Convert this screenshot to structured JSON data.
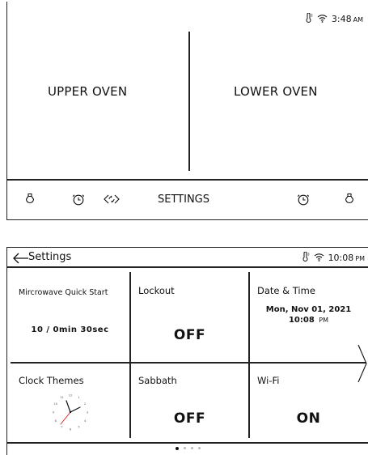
{
  "home": {
    "status": {
      "time": "3:48",
      "ampm": "AM"
    },
    "left_panel": {
      "label": "UPPER OVEN"
    },
    "right_panel": {
      "label": "LOWER OVEN"
    },
    "bottom_bar": {
      "settings_label": "SETTINGS"
    }
  },
  "settings": {
    "title": "Settings",
    "status": {
      "time": "10:08",
      "ampm": "PM"
    },
    "tiles": [
      {
        "title": "Mircrowave Quick Start",
        "value": "10 / 0min 30sec"
      },
      {
        "title": "Lockout",
        "value": "OFF"
      },
      {
        "title": "Date & Time",
        "date": "Mon, Nov 01, 2021",
        "time": "10:08",
        "ampm": "PM"
      },
      {
        "title": "Clock Themes",
        "clock_numbers": [
          "12",
          "1",
          "2",
          "3",
          "4",
          "5",
          "6",
          "7",
          "8",
          "9",
          "10",
          "11"
        ]
      },
      {
        "title": "Sabbath",
        "value": "OFF"
      },
      {
        "title": "Wi-Fi",
        "value": "ON"
      }
    ],
    "pager": {
      "pages": 4,
      "current": 1
    }
  },
  "icons": {
    "thermometer": "thermometer-icon",
    "wifi": "wifi-icon",
    "light": "light-bulb-icon",
    "timer": "timer-icon",
    "sync": "sync-icon",
    "back": "back-arrow-icon",
    "next": "chevron-right-icon",
    "clock": "analog-clock-icon"
  },
  "colors": {
    "clock_second_hand": "#e0262c"
  }
}
